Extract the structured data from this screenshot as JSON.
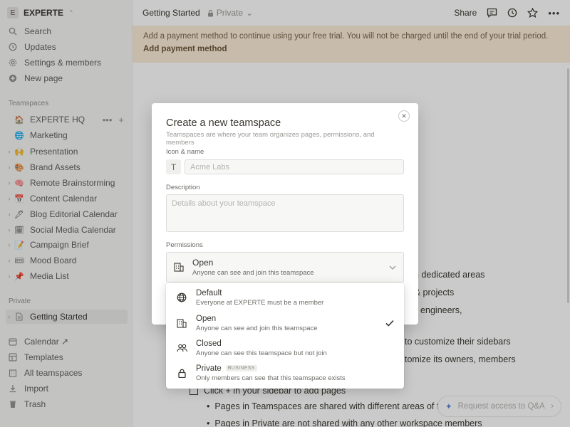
{
  "workspace": {
    "name": "EXPERTE",
    "initial": "E"
  },
  "sidebar": {
    "nav": [
      {
        "label": "Search",
        "icon": "search-icon"
      },
      {
        "label": "Updates",
        "icon": "clock-icon"
      },
      {
        "label": "Settings & members",
        "icon": "gear-icon"
      },
      {
        "label": "New page",
        "icon": "plus-circle-icon"
      }
    ],
    "teamspaces_label": "Teamspaces",
    "teamspaces": [
      {
        "label": "EXPERTE HQ",
        "emoji": "🏠"
      },
      {
        "label": "Marketing",
        "emoji": "🌐"
      }
    ],
    "pages": [
      {
        "label": "Presentation",
        "emoji": "🙌"
      },
      {
        "label": "Brand Assets",
        "emoji": "🎨"
      },
      {
        "label": "Remote Brainstorming",
        "emoji": "🧠"
      },
      {
        "label": "Content Calendar",
        "emoji": "📅"
      },
      {
        "label": "Blog Editorial Calendar",
        "emoji": "🖋"
      },
      {
        "label": "Social Media Calendar",
        "emoji": "🗓"
      },
      {
        "label": "Campaign Brief",
        "emoji": "📝"
      },
      {
        "label": "Mood Board",
        "emoji": "🎟"
      },
      {
        "label": "Media List",
        "emoji": "📌"
      }
    ],
    "private_label": "Private",
    "private_pages": [
      {
        "label": "Getting Started"
      }
    ],
    "bottom": [
      {
        "label": "Calendar ↗",
        "icon": "calendar-icon"
      },
      {
        "label": "Templates",
        "icon": "templates-icon"
      },
      {
        "label": "All teamspaces",
        "icon": "grid-icon"
      },
      {
        "label": "Import",
        "icon": "import-icon"
      },
      {
        "label": "Trash",
        "icon": "trash-icon"
      }
    ]
  },
  "topbar": {
    "breadcrumb": "Getting Started",
    "privacy": "Private",
    "share": "Share"
  },
  "banner": {
    "message": "Add a payment method to continue using your free trial. You will not be charged until the end of your trial period.",
    "link": "Add payment method"
  },
  "doc_fragments": [
    "wn dedicated areas",
    "s & projects",
    "for engineers,",
    "to customize their sidebars",
    "tomize its owners, members",
    "Click + in your sidebar to add pages",
    "Pages in Teamspaces are shared with different areas of t",
    "Pages in Private are not shared with any other workspace members"
  ],
  "modal": {
    "title": "Create a new teamspace",
    "subtitle": "Teamspaces are where your team organizes pages, permissions, and members",
    "icon_name_label": "Icon & name",
    "icon_letter": "T",
    "name_placeholder": "Acme Labs",
    "description_label": "Description",
    "description_placeholder": "Details about your teamspace",
    "permissions_label": "Permissions",
    "selected_permission": {
      "title": "Open",
      "desc": "Anyone can see and join this teamspace"
    }
  },
  "dropdown": {
    "options": [
      {
        "title": "Default",
        "desc": "Everyone at EXPERTE must be a member",
        "icon": "globe-icon"
      },
      {
        "title": "Open",
        "desc": "Anyone can see and join this teamspace",
        "icon": "building-icon",
        "checked": true
      },
      {
        "title": "Closed",
        "desc": "Anyone can see this teamspace but not join",
        "icon": "people-icon"
      },
      {
        "title": "Private",
        "desc": "Only members can see that this teamspace exists",
        "icon": "lock-icon",
        "badge": "BUSINESS"
      }
    ]
  },
  "qa": {
    "label": "Request access to Q&A"
  }
}
